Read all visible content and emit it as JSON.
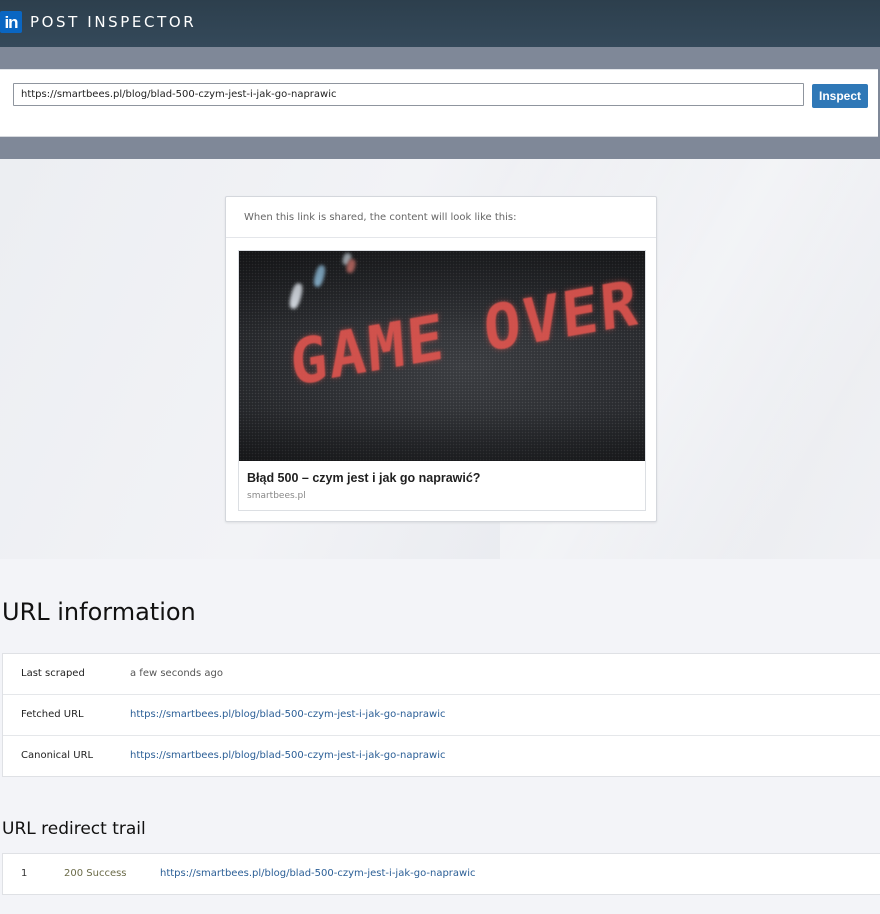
{
  "header": {
    "logo_text": "in",
    "title": "POST INSPECTOR"
  },
  "search": {
    "url_value": "https://smartbees.pl/blog/blad-500-czym-jest-i-jak-go-naprawic",
    "inspect_label": "Inspect"
  },
  "preview": {
    "caption": "When this link is shared, the content will look like this:",
    "image_text": "GAME OVER",
    "title": "Błąd 500 – czym jest i jak go naprawić?",
    "domain": "smartbees.pl"
  },
  "url_info": {
    "title": "URL information",
    "rows": [
      {
        "label": "Last scraped",
        "value": "a few seconds ago"
      },
      {
        "label": "Fetched URL",
        "value": "https://smartbees.pl/blog/blad-500-czym-jest-i-jak-go-naprawic"
      },
      {
        "label": "Canonical URL",
        "value": "https://smartbees.pl/blog/blad-500-czym-jest-i-jak-go-naprawic"
      }
    ]
  },
  "redirect_trail": {
    "title": "URL redirect trail",
    "rows": [
      {
        "index": "1",
        "status": "200 Success",
        "url": "https://smartbees.pl/blog/blad-500-czym-jest-i-jak-go-naprawic"
      }
    ]
  },
  "colors": {
    "brand": "#0a66c2",
    "header_bg": "#2d3f4d",
    "button": "#2f78b7",
    "link": "#2a5e96"
  }
}
